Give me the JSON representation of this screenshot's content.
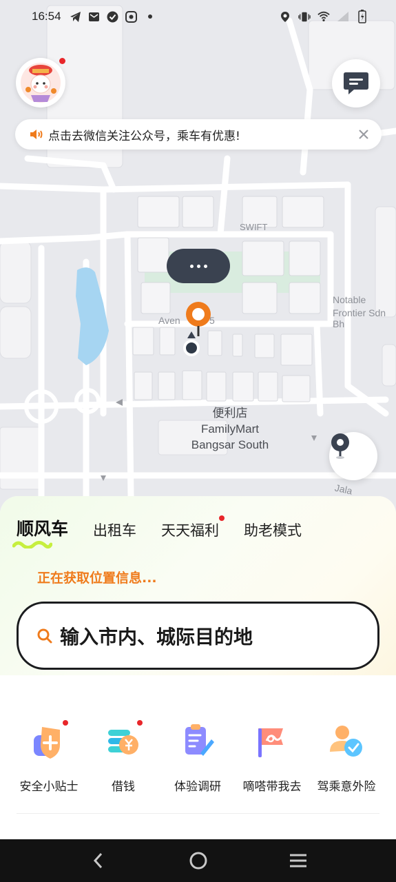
{
  "status_bar": {
    "time": "16:54",
    "left_icons": [
      "telegram-icon",
      "mail-icon",
      "check-circle-icon",
      "app-icon",
      "dot-icon"
    ],
    "right_icons": [
      "location-icon",
      "vibrate-icon",
      "wifi-icon",
      "signal-icon",
      "battery-icon"
    ]
  },
  "notice": {
    "text": "点击去微信关注公众号，乘车有优惠!",
    "icon": "speaker-icon",
    "close_icon": "close-icon"
  },
  "map": {
    "labels": {
      "swift": "SWIFT",
      "notable_line1": "Notable",
      "notable_line2": "Frontier Sdn Bh",
      "avenue": "Aven",
      "avenue_tail": "5",
      "jalan": "Jala"
    },
    "poi": {
      "line1": "便利店",
      "line2": "FamilyMart",
      "line3": "Bangsar South"
    }
  },
  "sheet": {
    "tabs": [
      {
        "label": "顺风车",
        "active": true
      },
      {
        "label": "出租车",
        "active": false
      },
      {
        "label": "天天福利",
        "active": false,
        "badge": true
      },
      {
        "label": "助老模式",
        "active": false
      }
    ],
    "location_status": "正在获取位置信息...",
    "search_placeholder": "输入市内、城际目的地",
    "shortcuts": [
      {
        "label": "安全小贴士",
        "icon": "shield-plus-icon",
        "badge": true
      },
      {
        "label": "借钱",
        "icon": "coin-stack-icon",
        "badge": true
      },
      {
        "label": "体验调研",
        "icon": "clipboard-pen-icon",
        "badge": false
      },
      {
        "label": "嘀嗒带我去",
        "icon": "flag-icon",
        "badge": false
      },
      {
        "label": "驾乘意外险",
        "icon": "user-shield-icon",
        "badge": false
      }
    ]
  },
  "colors": {
    "accent_orange": "#ef7b1c",
    "badge_red": "#e8262a",
    "map_bg": "#e8e9ed"
  }
}
